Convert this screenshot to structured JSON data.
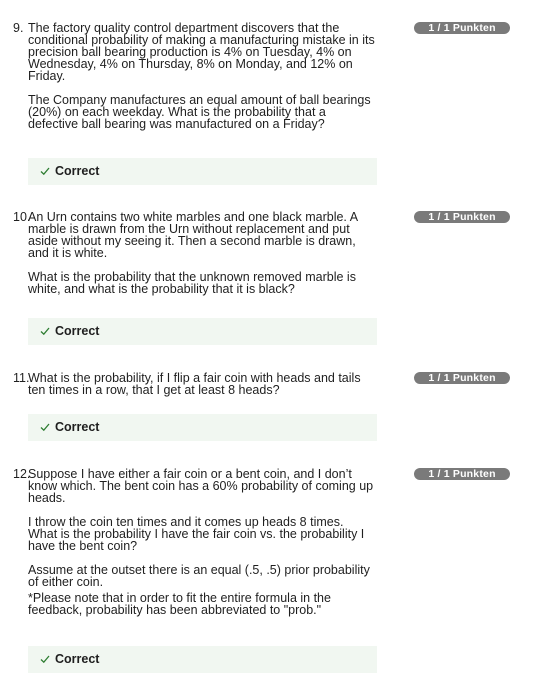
{
  "questions": [
    {
      "number": "9.",
      "badge": "1 / 1 Punkten",
      "paragraphs": [
        "The factory quality control department discovers that the conditional probability of making a manufacturing mistake in its precision ball bearing production is 4% on Tuesday, 4% on Wednesday, 4% on Thursday, 8% on Monday, and 12% on Friday.",
        "The Company manufactures an equal amount of ball bearings (20%) on each weekday. What is the probability that a defective ball bearing was manufactured on a Friday?"
      ],
      "feedback": "Correct"
    },
    {
      "number": "10.",
      "badge": "1 / 1 Punkten",
      "paragraphs": [
        "An Urn contains two white marbles and one black marble. A marble is drawn from the Urn without replacement and put aside without my seeing it. Then a second marble is drawn, and it is white.",
        "What is the probability that the unknown removed marble is white, and what is the probability that it is black?"
      ],
      "feedback": "Correct"
    },
    {
      "number": "11.",
      "badge": "1 / 1 Punkten",
      "paragraphs": [
        "What is the probability, if I flip a fair coin with heads and tails ten times in a row, that I get at least 8 heads?"
      ],
      "feedback": "Correct"
    },
    {
      "number": "12.",
      "badge": "1 / 1 Punkten",
      "paragraphs": [
        "Suppose I have either a fair coin or a bent coin, and I don’t know which. The bent coin has a 60% probability of coming up heads.",
        "I throw the coin ten times and it comes up heads 8 times. What is the probability I have the fair coin vs. the probability I have the bent coin?",
        "Assume at the outset there is an equal (.5, .5) prior probability of either coin.",
        "*Please note that in order to fit the entire formula in the feedback, probability has been abbreviated to \"prob.\""
      ],
      "feedback": "Correct"
    }
  ],
  "colors": {
    "badge_bg": "#7a7a7a",
    "badge_text": "#ffffff",
    "feedback_bg": "#f1f7f1",
    "check": "#2e7d32",
    "text": "#1f1f1f"
  },
  "icons": {
    "feedback": "check-icon"
  }
}
